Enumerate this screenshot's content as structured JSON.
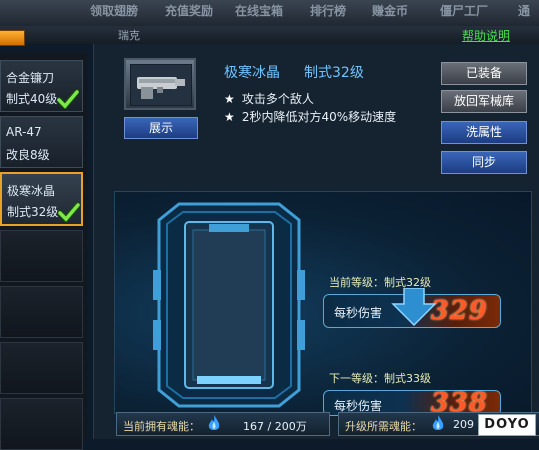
{
  "nav": {
    "tabs": [
      "领取翅膀",
      "充值奖励",
      "在线宝箱",
      "排行榜",
      "赚金币",
      "僵尸工厂",
      "通"
    ],
    "player_name": "瑞克",
    "help_link": "帮助说明"
  },
  "sidebar": {
    "items": [
      {
        "name": "合金镰刀",
        "level": "制式40级",
        "equipped": true,
        "active": false
      },
      {
        "name": "AR-47",
        "level": "改良8级",
        "equipped": false,
        "active": false
      },
      {
        "name": "极寒冰晶",
        "level": "制式32级",
        "equipped": true,
        "active": true
      }
    ]
  },
  "weapon": {
    "name": "极寒冰晶",
    "level": "制式32级",
    "show_button": "展示",
    "features": [
      {
        "star": "★",
        "text": "攻击多个敌人"
      },
      {
        "star": "★",
        "text": "2秒内降低对方40%移动速度"
      }
    ]
  },
  "actions": {
    "equipped": "已装备",
    "return": "放回军械库",
    "reroll": "洗属性",
    "sync": "同步"
  },
  "upgrade": {
    "current_label": "当前等级：制式32级",
    "next_label": "下一等级：制式33级",
    "dps_label": "每秒伤害",
    "current_dps": "329",
    "next_dps": "338"
  },
  "souls": {
    "owned_label": "当前拥有魂能：",
    "owned_value": "167 / 200万",
    "required_label": "升级所需魂能：",
    "required_value": "209"
  },
  "watermark": "DOYO",
  "colors": {
    "accent_blue": "#6fc4ff",
    "help_green": "#46e04a",
    "damage_red": "#ff5a28",
    "active_border": "#e8a226"
  }
}
